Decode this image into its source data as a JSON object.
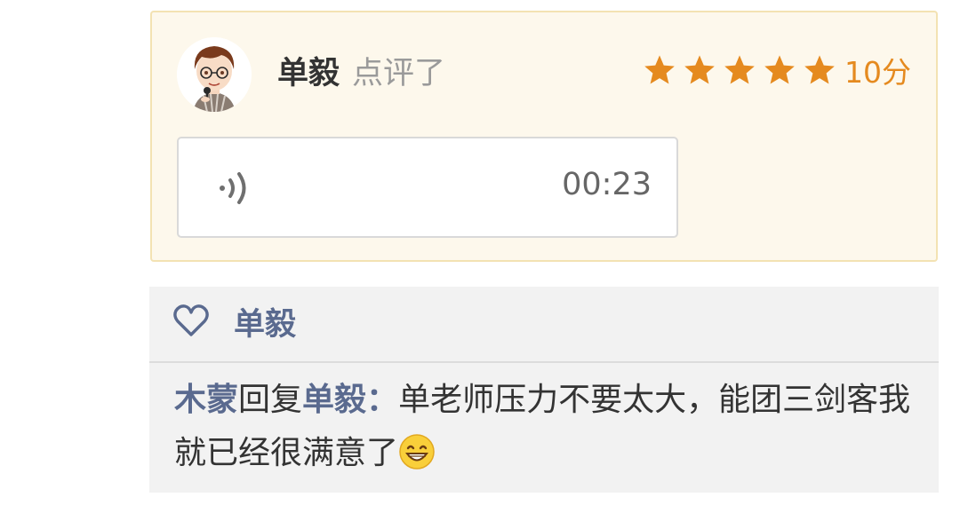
{
  "review": {
    "reviewer_name": "单毅",
    "verb": "点评了",
    "rating": {
      "stars": 5,
      "max_stars": 5,
      "score_label": "10分"
    },
    "voice": {
      "duration": "00:23"
    },
    "avatar_icon": "cartoon-avatar-icon"
  },
  "likes": {
    "icon": "heart-icon",
    "names": "单毅"
  },
  "reply": {
    "author": "木蒙",
    "verb": "回复",
    "target": "单毅",
    "colon": "：",
    "text": "单老师压力不要太大，能团三剑客我就已经很满意了",
    "emoji": "grinning-face-emoji"
  },
  "colors": {
    "card_bg": "#fdf8ec",
    "card_border": "#f3e2b3",
    "star": "#e58a1f",
    "link_name": "#5a6a8f",
    "panel_bg": "#f2f2f2"
  }
}
